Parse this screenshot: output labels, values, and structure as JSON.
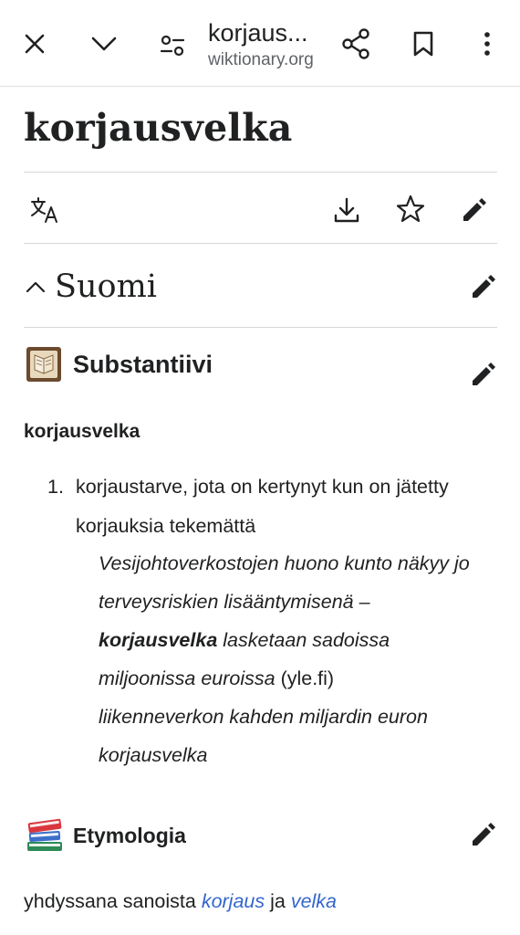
{
  "browser": {
    "tab_title": "korjaus...",
    "url": "wiktionary.org"
  },
  "page": {
    "title": "korjausvelka"
  },
  "language_section": {
    "name": "Suomi"
  },
  "noun_section": {
    "heading": "Substantiivi",
    "headword": "korjausvelka",
    "definitions": [
      {
        "number": "1.",
        "text": "korjaustarve, jota on kertynyt kun on jätetty korjauksia tekemättä"
      }
    ],
    "example1": {
      "part1": "Vesijohtoverkostojen huono kunto näkyy jo terveysriskien lisääntymisenä – ",
      "bold": "korjausvelka",
      "part2": " lasketaan sadoissa miljoonissa euroissa",
      "source": " (yle.fi)"
    },
    "example2": "liikenneverkon kahden miljardin euron korjausvelka"
  },
  "etymology_section": {
    "heading": "Etymologia",
    "text_before": "yhdyssana sanoista ",
    "link1": "korjaus",
    "text_middle": " ja ",
    "link2": "velka"
  },
  "colors": {
    "text": "#202122",
    "link": "#3366cc",
    "divider": "#d5d7da"
  }
}
